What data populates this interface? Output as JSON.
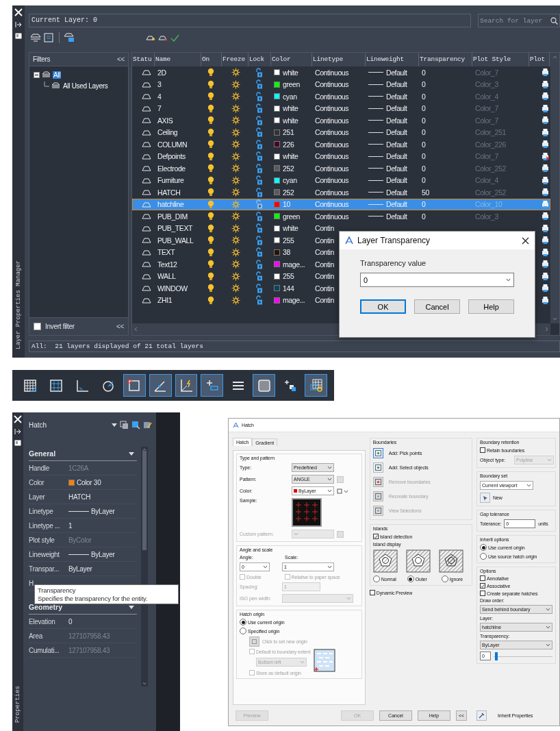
{
  "layer_manager": {
    "side_title": "Layer Properties Manager",
    "current_layer": "Current Layer: 0",
    "search": {
      "placeholder": "Search for layer"
    },
    "filters": {
      "title": "Filters",
      "collapse": "<<",
      "tree": [
        {
          "label": "All",
          "selected": true,
          "expanded": true,
          "children": [
            {
              "label": "All Used Layers",
              "selected": false
            }
          ]
        }
      ],
      "invert_filter": {
        "label": "Invert filter",
        "checked": false
      },
      "footer_collapse": "<<"
    },
    "columns": [
      "Statu",
      "Name",
      "On",
      "Freeze",
      "Lock",
      "Color",
      "Linetype",
      "Lineweight",
      "Transparency",
      "Plot Style",
      "Plot"
    ],
    "rows": [
      {
        "name": "2D",
        "color_name": "white",
        "color": "#ffffff",
        "linetype": "Continuous",
        "lineweight": "Default",
        "transparency": "0",
        "plot_style": "Color_7",
        "plot": true,
        "selected": false
      },
      {
        "name": "3",
        "color_name": "green",
        "color": "#00ff00",
        "linetype": "Continuous",
        "lineweight": "Default",
        "transparency": "0",
        "plot_style": "Color_3",
        "plot": true,
        "selected": false
      },
      {
        "name": "4",
        "color_name": "cyan",
        "color": "#00ffff",
        "linetype": "Continuous",
        "lineweight": "Default",
        "transparency": "0",
        "plot_style": "Color_4",
        "plot": true,
        "selected": false
      },
      {
        "name": "7",
        "color_name": "white",
        "color": "#ffffff",
        "linetype": "Continuous",
        "lineweight": "Default",
        "transparency": "0",
        "plot_style": "Color_7",
        "plot": true,
        "selected": false
      },
      {
        "name": "AXIS",
        "color_name": "white",
        "color": "#ffffff",
        "linetype": "Continuous",
        "lineweight": "Default",
        "transparency": "0",
        "plot_style": "Color_7",
        "plot": true,
        "selected": false
      },
      {
        "name": "Ceiling",
        "color_name": "251",
        "color": "#333333",
        "linetype": "Continuous",
        "lineweight": "Default",
        "transparency": "0",
        "plot_style": "Color_251",
        "plot": true,
        "selected": false
      },
      {
        "name": "COLUMN",
        "color_name": "226",
        "color": "#4c0026",
        "linetype": "Continuous",
        "lineweight": "Default",
        "transparency": "0",
        "plot_style": "Color_226",
        "plot": true,
        "selected": false
      },
      {
        "name": "Defpoints",
        "color_name": "white",
        "color": "#ffffff",
        "linetype": "Continuous",
        "lineweight": "Default",
        "transparency": "0",
        "plot_style": "Color_7",
        "plot": false,
        "selected": false
      },
      {
        "name": "Electrode",
        "color_name": "252",
        "color": "#5b5b5b",
        "linetype": "Continuous",
        "lineweight": "Default",
        "transparency": "0",
        "plot_style": "Color_252",
        "plot": true,
        "selected": false
      },
      {
        "name": "Furniture",
        "color_name": "cyan",
        "color": "#00ffff",
        "linetype": "Continuous",
        "lineweight": "Default",
        "transparency": "0",
        "plot_style": "Color_4",
        "plot": true,
        "selected": false
      },
      {
        "name": "HATCH",
        "color_name": "252",
        "color": "#5b5b5b",
        "linetype": "Continuous",
        "lineweight": "Default",
        "transparency": "50",
        "plot_style": "Color_252",
        "plot": true,
        "selected": false
      },
      {
        "name": "hatchline",
        "color_name": "10",
        "color": "#ff0000",
        "linetype": "Continuous",
        "lineweight": "Default",
        "transparency": "0",
        "plot_style": "Color_10",
        "plot": true,
        "selected": true
      },
      {
        "name": "PUB_DIM",
        "color_name": "green",
        "color": "#00ff00",
        "linetype": "Continuous",
        "lineweight": "Default",
        "transparency": "0",
        "plot_style": "Color_3",
        "plot": true,
        "selected": false
      },
      {
        "name": "PUB_TEXT",
        "color_name": "white",
        "color": "#ffffff",
        "linetype": "Contin",
        "plot": true,
        "selected": false
      },
      {
        "name": "PUB_WALL",
        "color_name": "255",
        "color": "#ffffff",
        "linetype": "Contin",
        "plot": true,
        "selected": false
      },
      {
        "name": "TEXT",
        "color_name": "38",
        "color": "#261300",
        "linetype": "Contin",
        "plot": true,
        "selected": false
      },
      {
        "name": "Text12",
        "color_name": "mage...",
        "color": "#ff00ff",
        "linetype": "Contin",
        "plot": true,
        "selected": false
      },
      {
        "name": "WALL",
        "color_name": "255",
        "color": "#ffffff",
        "linetype": "Contin",
        "plot": true,
        "selected": false
      },
      {
        "name": "WINDOW",
        "color_name": "144",
        "color": "#00465e",
        "linetype": "Contin",
        "plot": true,
        "selected": false
      },
      {
        "name": "ZHI1",
        "color_name": "mage...",
        "color": "#ff00ff",
        "linetype": "Contin",
        "plot": true,
        "selected": false
      }
    ],
    "status": "All:  21 layers displayed of 21 total layers"
  },
  "transparency_dialog": {
    "title": "Layer Transparency",
    "label": "Transparency value",
    "value": "0",
    "buttons": [
      {
        "label": "OK",
        "default": true
      },
      {
        "label": "Cancel",
        "default": false
      },
      {
        "label": "Help",
        "default": false
      }
    ]
  },
  "status_toolbar": {
    "buttons": [
      {
        "on": false
      },
      {
        "on": false
      },
      {
        "on": false
      },
      {
        "on": false
      },
      {
        "on": true
      },
      {
        "on": true
      },
      {
        "on": true
      },
      {
        "on": true
      },
      {
        "on": false
      },
      {
        "on": true
      },
      {
        "on": false
      },
      {
        "on": true
      }
    ]
  },
  "properties": {
    "side_title": "Properties",
    "object": "Hatch",
    "sections": [
      {
        "title": "General",
        "rows": [
          {
            "label": "Handle",
            "value": "1C26A",
            "kind": "text",
            "disabled": true
          },
          {
            "label": "Color",
            "value": "Color 30",
            "kind": "swatch",
            "color": "#ff8000",
            "disabled": false
          },
          {
            "label": "Layer",
            "value": "HATCH",
            "kind": "text",
            "disabled": false
          },
          {
            "label": "Linetype",
            "value": "ByLayer",
            "kind": "line",
            "disabled": false
          },
          {
            "label": "Linetype ...",
            "value": "1",
            "kind": "text",
            "disabled": false
          },
          {
            "label": "Plot style",
            "value": "ByColor",
            "kind": "text",
            "disabled": true
          },
          {
            "label": "Lineweight",
            "value": "ByLayer",
            "kind": "line",
            "disabled": false
          },
          {
            "label": "Transpar...",
            "value": "ByLayer",
            "kind": "text",
            "disabled": false
          },
          {
            "label": "H",
            "kind": "text"
          }
        ]
      },
      {
        "title": "Geometry",
        "rows": [
          {
            "label": "Elevation",
            "value": "0",
            "kind": "text",
            "disabled": false
          },
          {
            "label": "Area",
            "value": "127107958.43",
            "kind": "text",
            "disabled": true
          },
          {
            "label": "Cumulati...",
            "value": "127107958.43",
            "kind": "text",
            "disabled": true
          }
        ]
      }
    ],
    "tooltip": {
      "title": "Transparency",
      "text": "Specifies the transparency for the entity."
    }
  },
  "hatch_dialog": {
    "title": "Hatch",
    "tabs": [
      {
        "label": "Hatch",
        "selected": true
      },
      {
        "label": "Gradient",
        "selected": false
      }
    ],
    "type_pattern": {
      "title": "Type and pattern",
      "type_label": "Type:",
      "type": "Predefined",
      "pattern_label": "Pattern:",
      "pattern": "ANGLE",
      "color_label": "Color:",
      "color_setting": "ByLayer",
      "sample_label": "Sample:",
      "custom": {
        "label": "Custom pattern:",
        "disabled": true
      }
    },
    "angle_scale": {
      "title": "Angle and scale",
      "angle_label": "Angle:",
      "angle": "0",
      "scale_label": "Scale:",
      "scale": "1",
      "double": {
        "label": "Double",
        "checked": false,
        "disabled": true
      },
      "relative": {
        "label": "Relative to paper space",
        "checked": false,
        "disabled": true
      },
      "spacing": {
        "label": "Spacing:",
        "value": "1",
        "disabled": true
      },
      "iso": {
        "label": "ISO pen width:",
        "disabled": true
      }
    },
    "origin": {
      "title": "Hatch origin",
      "options": [
        {
          "label": "Use current origin",
          "selected": true
        },
        {
          "label": "Specified origin",
          "selected": false
        }
      ],
      "click": {
        "label": "Click to set new origin",
        "disabled": true
      },
      "default_extent": {
        "label": "Default to boundary extent",
        "checked": false,
        "disabled": true
      },
      "position": {
        "value": "Bottom left",
        "disabled": true
      },
      "store": {
        "label": "Store as default origin",
        "checked": false,
        "disabled": true
      }
    },
    "boundaries": {
      "title": "Boundaries",
      "items": [
        {
          "label": "Add: Pick points",
          "disabled": false
        },
        {
          "label": "Add: Select objects",
          "disabled": false
        },
        {
          "label": "Remove boundaries",
          "disabled": true
        },
        {
          "label": "Recreate boundary",
          "disabled": true
        },
        {
          "label": "View Selections",
          "disabled": true
        }
      ]
    },
    "islands": {
      "title": "Islands",
      "detection": {
        "label": "Island detection",
        "checked": true,
        "disabled": false
      },
      "display_label": "Island display",
      "styles": [
        {
          "label": "Normal",
          "selected": false
        },
        {
          "label": "Outer",
          "selected": true
        },
        {
          "label": "Ignore",
          "selected": false
        }
      ]
    },
    "dynamic_preview": {
      "label": "Dynamic Preview",
      "checked": false,
      "disabled": false
    },
    "retention": {
      "title": "Boundary retention",
      "retain": {
        "label": "Retain boundaries",
        "checked": false,
        "disabled": false
      },
      "object_type": {
        "label": "Object type:",
        "value": "Polyline",
        "disabled": true
      }
    },
    "boundary_set": {
      "title": "Boundary set",
      "value": "Current viewport",
      "new_label": "New"
    },
    "gap": {
      "title": "Gap tolerance",
      "label": "Tolerance:",
      "value": "0",
      "unit": "units"
    },
    "inherit": {
      "title": "Inherit options",
      "options": [
        {
          "label": "Use current origin",
          "selected": true
        },
        {
          "label": "Use source hatch origin",
          "selected": false
        }
      ]
    },
    "options": {
      "title": "Options",
      "checks": [
        {
          "label": "Annotative",
          "checked": false,
          "disabled": false
        },
        {
          "label": "Associative",
          "checked": true,
          "disabled": false
        },
        {
          "label": "Create separate hatches",
          "checked": false,
          "disabled": false
        }
      ],
      "draw_order_label": "Draw order:",
      "draw_order": "Send behind boundary",
      "layer_label": "Layer:",
      "layer": "hatchline",
      "transparency_label": "Transparency:",
      "transparency": "ByLayer",
      "transparency_value": "0",
      "level": 0.02
    },
    "buttons": [
      {
        "label": "Preview",
        "disabled": true
      },
      {
        "label": "OK",
        "disabled": true
      },
      {
        "label": "Cancel",
        "disabled": false
      },
      {
        "label": "Help",
        "disabled": false
      },
      {
        "label": "<<",
        "disabled": false
      }
    ],
    "inherit_properties": "Inherit Properties"
  }
}
